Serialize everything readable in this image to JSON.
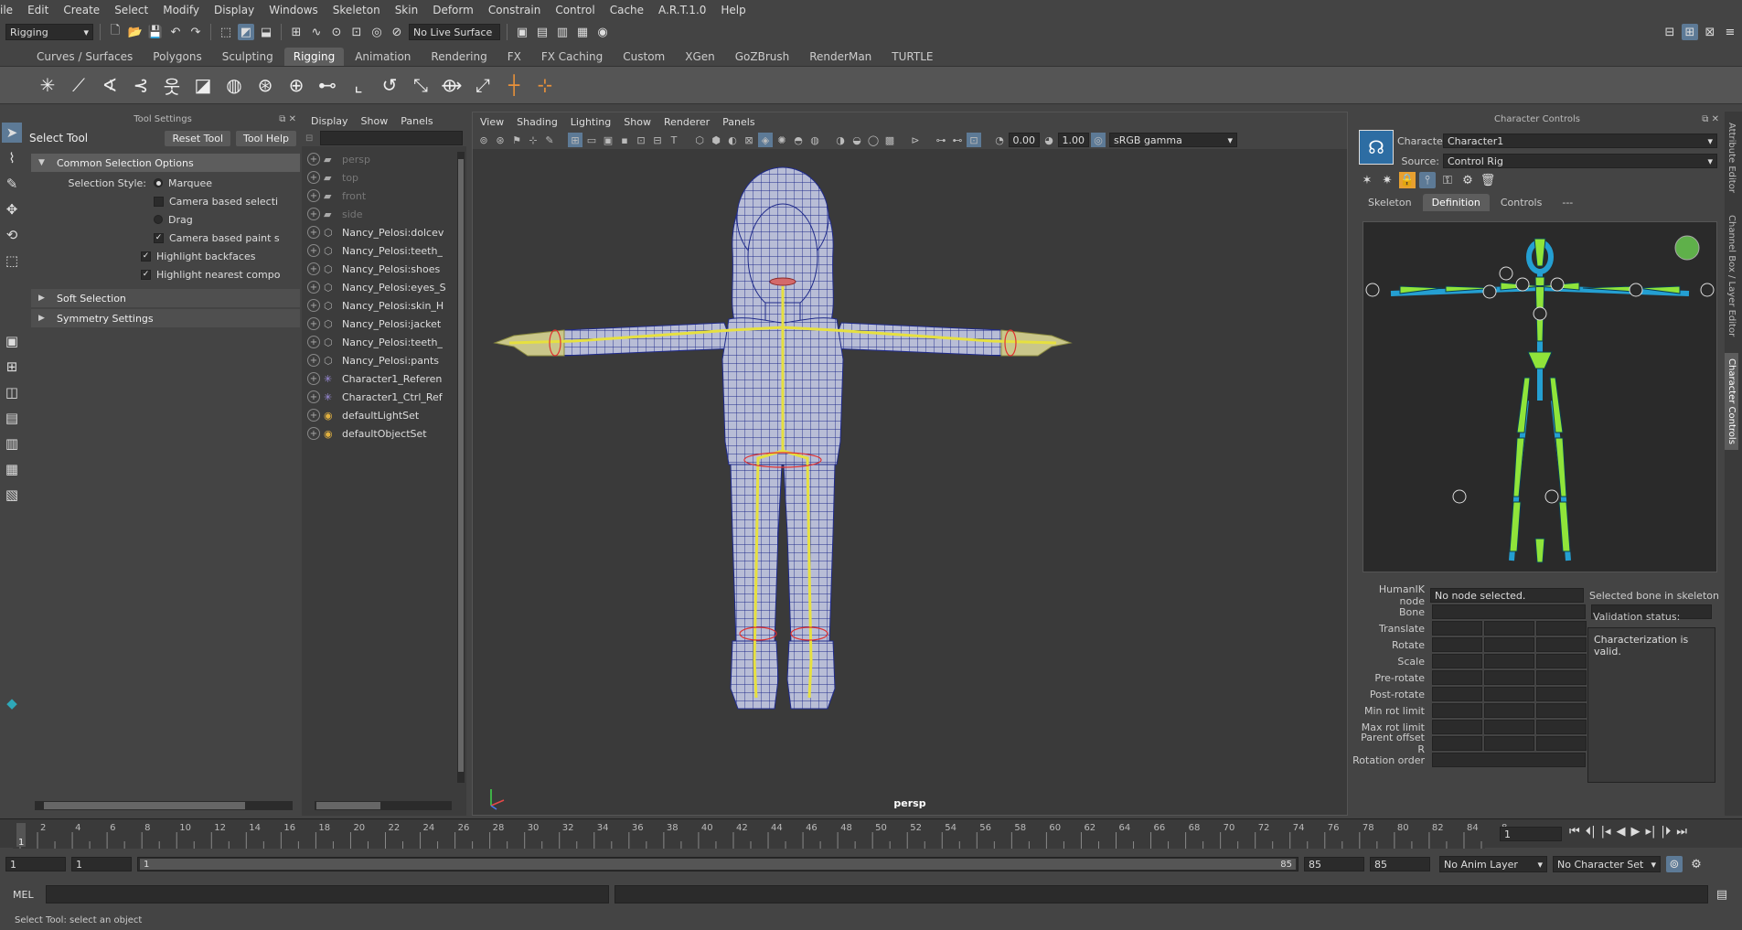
{
  "menubar": [
    "ile",
    "Edit",
    "Create",
    "Select",
    "Modify",
    "Display",
    "Windows",
    "Skeleton",
    "Skin",
    "Deform",
    "Constrain",
    "Control",
    "Cache",
    "A.R.T.1.0",
    "Help"
  ],
  "status": {
    "menuset": "Rigging",
    "live_surface": "No Live Surface"
  },
  "shelf_tabs": [
    {
      "label": "Curves / Surfaces",
      "active": false
    },
    {
      "label": "Polygons",
      "active": false
    },
    {
      "label": "Sculpting",
      "active": false
    },
    {
      "label": "Rigging",
      "active": true
    },
    {
      "label": "Animation",
      "active": false
    },
    {
      "label": "Rendering",
      "active": false
    },
    {
      "label": "FX",
      "active": false
    },
    {
      "label": "FX Caching",
      "active": false
    },
    {
      "label": "Custom",
      "active": false
    },
    {
      "label": "XGen",
      "active": false
    },
    {
      "label": "GoZBrush",
      "active": false
    },
    {
      "label": "RenderMan",
      "active": false
    },
    {
      "label": "TURTLE",
      "active": false
    }
  ],
  "tool_settings": {
    "panel_title": "Tool Settings",
    "tool_name": "Select Tool",
    "reset_label": "Reset Tool",
    "help_label": "Tool Help",
    "common_header": "Common Selection Options",
    "selection_style_label": "Selection Style:",
    "marquee": "Marquee",
    "camera_based_selection": "Camera based selecti",
    "drag": "Drag",
    "camera_based_paint": "Camera based paint s",
    "highlight_backfaces": "Highlight backfaces",
    "highlight_nearest": "Highlight nearest compo",
    "soft_selection": "Soft Selection",
    "symmetry_settings": "Symmetry Settings"
  },
  "outliner": {
    "menus": [
      "Display",
      "Show",
      "Panels"
    ],
    "items": [
      {
        "label": "persp",
        "icon": "camera-icon",
        "dim": true
      },
      {
        "label": "top",
        "icon": "camera-icon",
        "dim": true
      },
      {
        "label": "front",
        "icon": "camera-icon",
        "dim": true
      },
      {
        "label": "side",
        "icon": "camera-icon",
        "dim": true
      },
      {
        "label": "Nancy_Pelosi:dolcev",
        "icon": "mesh-icon",
        "dim": false
      },
      {
        "label": "Nancy_Pelosi:teeth_",
        "icon": "mesh-icon",
        "dim": false
      },
      {
        "label": "Nancy_Pelosi:shoes",
        "icon": "mesh-icon",
        "dim": false
      },
      {
        "label": "Nancy_Pelosi:eyes_S",
        "icon": "mesh-icon",
        "dim": false
      },
      {
        "label": "Nancy_Pelosi:skin_H",
        "icon": "mesh-icon",
        "dim": false
      },
      {
        "label": "Nancy_Pelosi:jacket",
        "icon": "mesh-icon",
        "dim": false
      },
      {
        "label": "Nancy_Pelosi:teeth_",
        "icon": "mesh-icon",
        "dim": false
      },
      {
        "label": "Nancy_Pelosi:pants",
        "icon": "mesh-icon",
        "dim": false
      },
      {
        "label": "Character1_Referen",
        "icon": "joint-icon",
        "dim": false
      },
      {
        "label": "Character1_Ctrl_Ref",
        "icon": "joint-icon",
        "dim": false
      },
      {
        "label": "defaultLightSet",
        "icon": "set-icon",
        "dim": false
      },
      {
        "label": "defaultObjectSet",
        "icon": "set-icon",
        "dim": false
      }
    ]
  },
  "viewport": {
    "menus": [
      "View",
      "Shading",
      "Lighting",
      "Show",
      "Renderer",
      "Panels"
    ],
    "exposure": "0.00",
    "gamma": "1.00",
    "color_space": "sRGB gamma",
    "camera_label": "persp"
  },
  "character_controls": {
    "title": "Character Controls",
    "character_label": "Character:",
    "character_value": "Character1",
    "source_label": "Source:",
    "source_value": "Control Rig",
    "tabs": [
      "Skeleton",
      "Definition",
      "Controls",
      "---"
    ],
    "active_tab": "Definition",
    "humanik_label": "HumanIK node",
    "humanik_value": "No node selected.",
    "selected_bone_label": "Selected bone in skeleton",
    "rows": [
      "Bone",
      "Translate",
      "Rotate",
      "Scale",
      "Pre-rotate",
      "Post-rotate",
      "Min rot limit",
      "Max rot limit",
      "Parent offset R",
      "Rotation order"
    ],
    "validation_label": "Validation status:",
    "validation_value": "Characterization is valid.",
    "status_color": "#5fb04a",
    "bone_color": "#8fe43a",
    "outline_color": "#23b4f0"
  },
  "right_tabs": [
    "Attribute Editor",
    "Channel Box / Layer Editor",
    "Character Controls"
  ],
  "timeline": {
    "ticks": [
      "2",
      "4",
      "6",
      "8",
      "10",
      "12",
      "14",
      "16",
      "18",
      "20",
      "22",
      "24",
      "26",
      "28",
      "30",
      "32",
      "34",
      "36",
      "38",
      "40",
      "42",
      "44",
      "46",
      "48",
      "50",
      "52",
      "54",
      "56",
      "58",
      "60",
      "62",
      "64",
      "66",
      "68",
      "70",
      "72",
      "74",
      "76",
      "78",
      "80",
      "82",
      "84",
      "8"
    ],
    "current_frame": "1",
    "current_frame_field": "1"
  },
  "range": {
    "start": "1",
    "start2": "1",
    "slider_left": "1",
    "slider_right": "85",
    "end": "85",
    "end2": "85",
    "anim_layer": "No Anim Layer",
    "character_set": "No Character Set"
  },
  "command": {
    "mode": "MEL"
  },
  "help_line": "Select Tool: select an object"
}
